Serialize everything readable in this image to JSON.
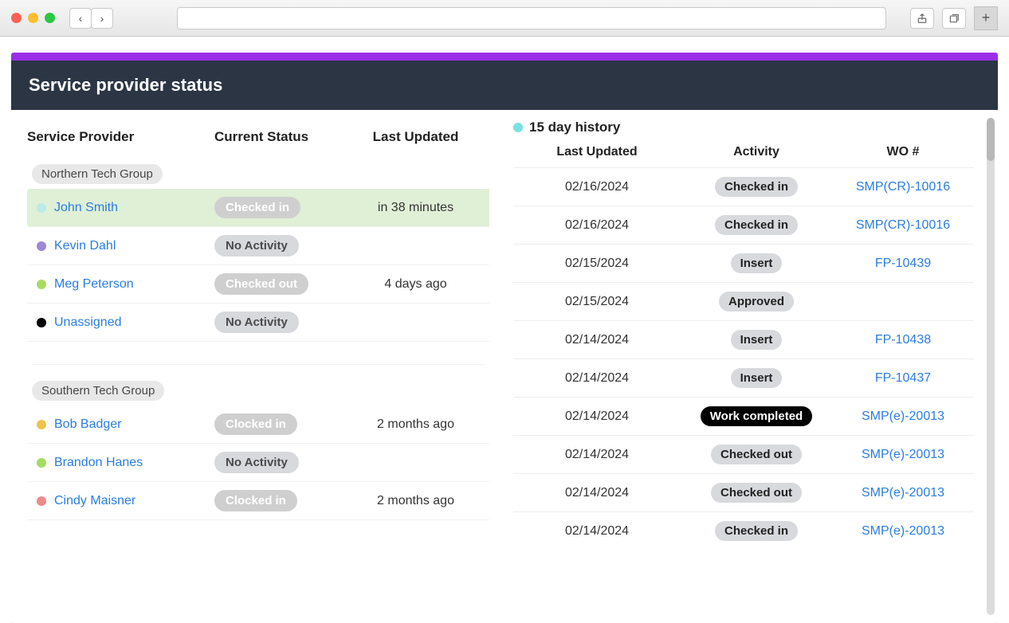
{
  "chrome": {
    "back_label": "‹",
    "forward_label": "›",
    "share_label": "⇧",
    "tabs_label": "❐",
    "newtab_label": "+"
  },
  "page_title": "Service provider status",
  "left": {
    "headers": {
      "provider": "Service Provider",
      "status": "Current Status",
      "updated": "Last Updated"
    },
    "groups": [
      {
        "name": "Northern Tech Group",
        "rows": [
          {
            "color": "#b9ece9",
            "name": "John Smith",
            "status": "Checked in",
            "status_style": "white",
            "updated": "in 38 minutes",
            "selected": true
          },
          {
            "color": "#9b88d6",
            "name": "Kevin Dahl",
            "status": "No Activity",
            "status_style": "",
            "updated": ""
          },
          {
            "color": "#a5dc60",
            "name": "Meg Peterson",
            "status": "Checked out",
            "status_style": "white",
            "updated": "4 days ago"
          },
          {
            "color": "#000000",
            "name": "Unassigned",
            "status": "No Activity",
            "status_style": "",
            "updated": ""
          }
        ]
      },
      {
        "name": "Southern Tech Group",
        "rows": [
          {
            "color": "#eec34a",
            "name": "Bob Badger",
            "status": "Clocked in",
            "status_style": "white",
            "updated": "2 months ago"
          },
          {
            "color": "#a5dc60",
            "name": "Brandon Hanes",
            "status": "No Activity",
            "status_style": "",
            "updated": ""
          },
          {
            "color": "#ef8a8a",
            "name": "Cindy Maisner",
            "status": "Clocked in",
            "status_style": "white",
            "updated": "2 months ago"
          }
        ]
      }
    ]
  },
  "right": {
    "title": "15 day history",
    "headers": {
      "updated": "Last Updated",
      "activity": "Activity",
      "wo": "WO #"
    },
    "rows": [
      {
        "date": "02/16/2024",
        "activity": "Checked in",
        "style": "",
        "wo": "SMP(CR)-10016"
      },
      {
        "date": "02/16/2024",
        "activity": "Checked in",
        "style": "",
        "wo": "SMP(CR)-10016"
      },
      {
        "date": "02/15/2024",
        "activity": "Insert",
        "style": "",
        "wo": "FP-10439"
      },
      {
        "date": "02/15/2024",
        "activity": "Approved",
        "style": "",
        "wo": ""
      },
      {
        "date": "02/14/2024",
        "activity": "Insert",
        "style": "",
        "wo": "FP-10438"
      },
      {
        "date": "02/14/2024",
        "activity": "Insert",
        "style": "",
        "wo": "FP-10437"
      },
      {
        "date": "02/14/2024",
        "activity": "Work completed",
        "style": "black",
        "wo": "SMP(e)-20013"
      },
      {
        "date": "02/14/2024",
        "activity": "Checked out",
        "style": "",
        "wo": "SMP(e)-20013"
      },
      {
        "date": "02/14/2024",
        "activity": "Checked out",
        "style": "",
        "wo": "SMP(e)-20013"
      },
      {
        "date": "02/14/2024",
        "activity": "Checked in",
        "style": "",
        "wo": "SMP(e)-20013"
      }
    ]
  }
}
